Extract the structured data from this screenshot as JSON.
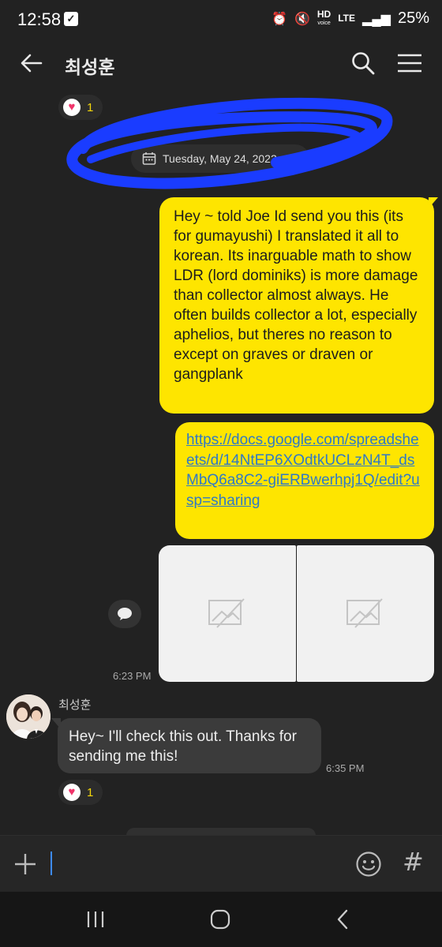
{
  "status_bar": {
    "time": "12:58",
    "hd_label": "HD",
    "hd_sub": "voice",
    "network": "LTE",
    "battery": "25%"
  },
  "header": {
    "title": "최성훈",
    "icons": [
      "back-arrow-icon",
      "search-icon",
      "menu-icon"
    ]
  },
  "reactions": [
    {
      "icon": "heart-icon",
      "count": "1"
    },
    {
      "icon": "heart-icon",
      "count": "1"
    }
  ],
  "date_divider": "Tuesday, May 24, 2022",
  "messages": {
    "outgoing_text": "Hey ~ told Joe Id send you this (its for gumayushi) I translated it all to korean. Its inarguable math to show LDR (lord dominiks) is more damage than collector almost always. He often builds collector a lot, especially aphelios, but theres no reason to except on graves or draven or gangplank",
    "outgoing_link": "https://docs.google.com/spreadsheets/d/14NtEP6XOdtkUCLzN4T_dsMbQ6a8C2-giERBwerhpj1Q/edit?usp=sharing",
    "outgoing_time": "6:23 PM",
    "sender_name": "최성훈",
    "incoming_text": "Hey~ I'll check this out. Thanks for sending me this!",
    "incoming_time": "6:35 PM"
  },
  "input": {
    "placeholder": "",
    "icons": [
      "plus-icon",
      "emoji-icon",
      "hash-icon"
    ]
  },
  "colors": {
    "my_bubble": "#fee500",
    "their_bubble": "#3b3b3b",
    "background": "#222222",
    "link": "#2f79c7",
    "scribble": "#1a3cff"
  }
}
